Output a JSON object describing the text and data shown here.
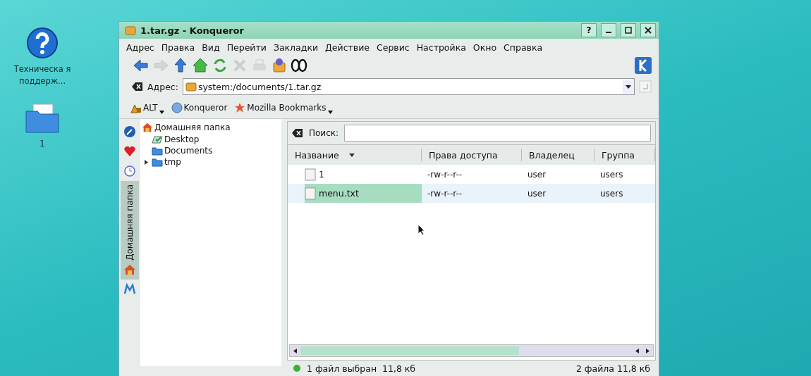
{
  "desktop_icons": [
    {
      "kind": "help",
      "label": "Техническа я поддерж..."
    },
    {
      "kind": "folder",
      "label": "1"
    }
  ],
  "window": {
    "title": "1.tar.gz - Konqueror",
    "buttons": [
      "?"
    ]
  },
  "menu": [
    "Адрес",
    "Правка",
    "Вид",
    "Перейти",
    "Закладки",
    "Действие",
    "Сервис",
    "Настройка",
    "Окно",
    "Справка"
  ],
  "toolbar": [
    {
      "kind": "back",
      "disabled": false
    },
    {
      "kind": "forward",
      "disabled": true
    },
    {
      "kind": "up",
      "disabled": false
    },
    {
      "kind": "home",
      "disabled": false
    },
    {
      "kind": "reload",
      "disabled": false
    },
    {
      "kind": "stop",
      "disabled": true
    },
    {
      "kind": "print",
      "disabled": true
    },
    {
      "kind": "package",
      "disabled": false
    },
    {
      "kind": "find",
      "disabled": false
    }
  ],
  "address": {
    "label": "Адрес:",
    "value": "system:/documents/1.tar.gz"
  },
  "bookmarks": [
    {
      "kind": "alt",
      "label": "ALT",
      "has_menu": true
    },
    {
      "kind": "globe",
      "label": "Konqueror",
      "has_menu": false
    },
    {
      "kind": "star",
      "label": "Mozilla Bookmarks",
      "has_menu": true
    }
  ],
  "side_tabs": [
    {
      "kind": "compass",
      "selected": false
    },
    {
      "kind": "heart",
      "selected": false
    },
    {
      "kind": "clock",
      "selected": false
    },
    {
      "kind": "home",
      "label": "Домашняя папка",
      "selected": true
    },
    {
      "kind": "m",
      "selected": false
    }
  ],
  "tree": {
    "label": "Домашняя папка",
    "children": [
      {
        "kind": "desktop",
        "label": "Desktop",
        "collapsed": false
      },
      {
        "kind": "folder",
        "label": "Documents",
        "collapsed": false
      },
      {
        "kind": "folder",
        "label": "tmp",
        "collapsed": true
      }
    ]
  },
  "search": {
    "label": "Поиск:"
  },
  "table": {
    "columns": [
      "Название",
      "Права доступа",
      "Владелец",
      "Группа"
    ],
    "rows": [
      {
        "name": "1",
        "perms": "-rw-r--r--",
        "owner": "user",
        "group": "users",
        "selected": false
      },
      {
        "name": "menu.txt",
        "perms": "-rw-r--r--",
        "owner": "user",
        "group": "users",
        "selected": true
      }
    ]
  },
  "status_bar": {
    "left": "1 файл выбран  11,8 кб",
    "right": "2 файла 11,8 кб"
  }
}
